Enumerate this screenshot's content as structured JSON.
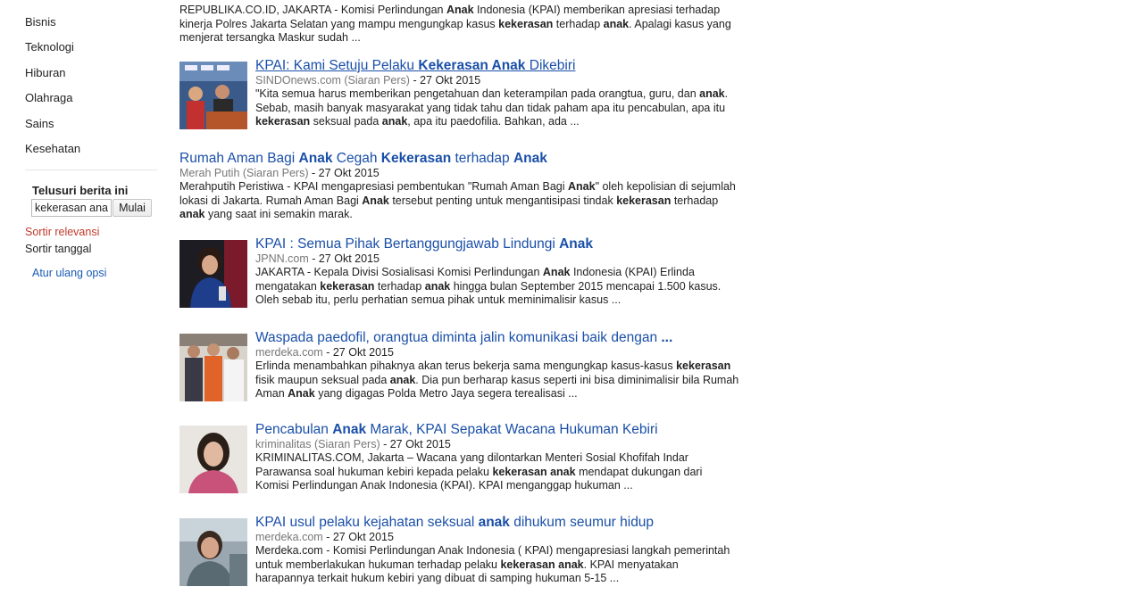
{
  "sidebar": {
    "categories": [
      "Bisnis",
      "Teknologi",
      "Hiburan",
      "Olahraga",
      "Sains",
      "Kesehatan"
    ],
    "search_heading": "Telusuri berita ini",
    "search_value": "kekerasan anak",
    "search_button": "Mulai",
    "sort_relevance": "Sortir relevansi",
    "sort_date": "Sortir tanggal",
    "reset_options": "Atur ulang opsi"
  },
  "results": [
    {
      "title": [],
      "source": "",
      "date": "",
      "snippet": [
        [
          "REPUBLIKA.CO.ID, JAKARTA - Komisi Perlindungan ",
          false
        ],
        [
          "Anak",
          true
        ],
        [
          " Indonesia (KPAI) memberikan apresiasi terhadap kinerja Polres Jakarta Selatan yang mampu mengungkap kasus ",
          false
        ],
        [
          "kekerasan",
          true
        ],
        [
          " terhadap ",
          false
        ],
        [
          "anak",
          true
        ],
        [
          ". Apalagi kasus yang menjerat tersangka Maskur sudah ...",
          false
        ]
      ]
    },
    {
      "title": [
        [
          "KPAI: Kami Setuju Pelaku ",
          false
        ],
        [
          "Kekerasan Anak",
          true
        ],
        [
          " Dikebiri",
          false
        ]
      ],
      "source": "SINDOnews.com (Siaran Pers)",
      "date": "27 Okt 2015",
      "snippet": [
        [
          "\"Kita semua harus memberikan pengetahuan dan keterampilan pada orangtua, guru, dan ",
          false
        ],
        [
          "anak",
          true
        ],
        [
          ". Sebab, masih banyak masyarakat yang tidak tahu dan tidak paham apa itu pencabulan, apa itu ",
          false
        ],
        [
          "kekerasan",
          true
        ],
        [
          " seksual pada ",
          false
        ],
        [
          "anak",
          true
        ],
        [
          ", apa itu paedofilia. Bahkan, ada ...",
          false
        ]
      ]
    },
    {
      "title": [
        [
          "Rumah Aman Bagi ",
          false
        ],
        [
          "Anak",
          true
        ],
        [
          " Cegah ",
          false
        ],
        [
          "Kekerasan",
          true
        ],
        [
          " terhadap ",
          false
        ],
        [
          "Anak",
          true
        ]
      ],
      "source": "Merah Putih (Siaran Pers)",
      "date": "27 Okt 2015",
      "snippet": [
        [
          "Merahputih Peristiwa - KPAI mengapresiasi pembentukan \"Rumah Aman Bagi ",
          false
        ],
        [
          "Anak",
          true
        ],
        [
          "\" oleh kepolisian di sejumlah lokasi di Jakarta. Rumah Aman Bagi ",
          false
        ],
        [
          "Anak",
          true
        ],
        [
          " tersebut penting untuk mengantisipasi tindak ",
          false
        ],
        [
          "kekerasan",
          true
        ],
        [
          " terhadap ",
          false
        ],
        [
          "anak",
          true
        ],
        [
          " yang saat ini semakin marak.",
          false
        ]
      ]
    },
    {
      "title": [
        [
          "KPAI : Semua Pihak Bertanggungjawab Lindungi ",
          false
        ],
        [
          "Anak",
          true
        ]
      ],
      "source": "JPNN.com",
      "date": "27 Okt 2015",
      "snippet": [
        [
          "JAKARTA - Kepala Divisi Sosialisasi Komisi Perlindungan ",
          false
        ],
        [
          "Anak",
          true
        ],
        [
          " Indonesia (KPAI) Erlinda mengatakan ",
          false
        ],
        [
          "kekerasan",
          true
        ],
        [
          " terhadap ",
          false
        ],
        [
          "anak",
          true
        ],
        [
          " hingga bulan September 2015 mencapai 1.500 kasus. Oleh sebab itu, perlu perhatian semua pihak untuk meminimalisir kasus ...",
          false
        ]
      ]
    },
    {
      "title": [
        [
          "Waspada paedofil, orangtua diminta jalin komunikasi baik dengan ",
          false
        ],
        [
          "...",
          true
        ]
      ],
      "source": "merdeka.com",
      "date": "27 Okt 2015",
      "snippet": [
        [
          "Erlinda menambahkan pihaknya akan terus bekerja sama mengungkap kasus-kasus ",
          false
        ],
        [
          "kekerasan",
          true
        ],
        [
          " fisik maupun seksual pada ",
          false
        ],
        [
          "anak",
          true
        ],
        [
          ". Dia pun berharap kasus seperti ini bisa diminimalisir bila Rumah Aman ",
          false
        ],
        [
          "Anak",
          true
        ],
        [
          " yang digagas Polda Metro Jaya segera terealisasi ...",
          false
        ]
      ]
    },
    {
      "title": [
        [
          "Pencabulan ",
          false
        ],
        [
          "Anak",
          true
        ],
        [
          " Marak, KPAI Sepakat Wacana Hukuman Kebiri",
          false
        ]
      ],
      "source": "kriminalitas (Siaran Pers)",
      "date": "27 Okt 2015",
      "snippet": [
        [
          "KRIMINALITAS.COM, Jakarta – Wacana yang dilontarkan Menteri Sosial Khofifah Indar Parawansa soal hukuman kebiri kepada pelaku ",
          false
        ],
        [
          "kekerasan anak",
          true
        ],
        [
          " mendapat dukungan dari Komisi Perlindungan Anak Indonesia (KPAI). KPAI menganggap hukuman ...",
          false
        ]
      ]
    },
    {
      "title": [
        [
          "KPAI usul pelaku kejahatan seksual ",
          false
        ],
        [
          "anak",
          true
        ],
        [
          " dihukum seumur hidup",
          false
        ]
      ],
      "source": "merdeka.com",
      "date": "27 Okt 2015",
      "snippet": [
        [
          "Merdeka.com - Komisi Perlindungan Anak Indonesia ( KPAI) mengapresiasi langkah pemerintah untuk memberlakukan hukuman terhadap pelaku ",
          false
        ],
        [
          "kekerasan anak",
          true
        ],
        [
          ". KPAI menyatakan harapannya terkait hukum kebiri yang dibuat di samping hukuman 5-15 ...",
          false
        ]
      ]
    }
  ],
  "colors": {
    "link": "#1a4fa8",
    "source": "#777777",
    "sort_active": "#c0392b",
    "reset": "#1a5bb5"
  }
}
